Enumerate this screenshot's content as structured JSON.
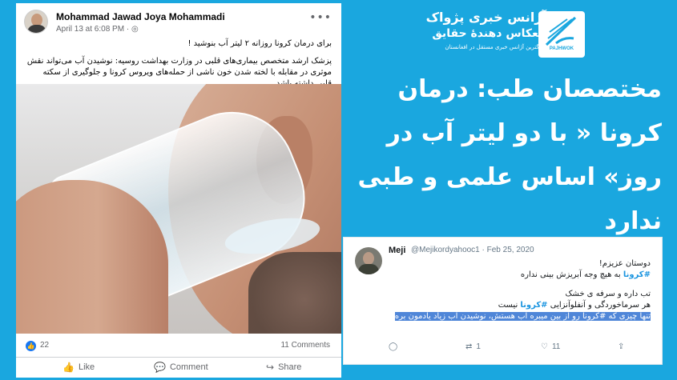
{
  "facebook_post": {
    "author": "Mohammad Jawad Joya Mohammadi",
    "date": "April 13 at 6:08 PM · ",
    "globe_glyph": "◎",
    "more_glyph": "•••",
    "text_line1": "برای درمان کرونا روزانه ۲ لیتر آب بنوشید !",
    "text_line2": "پزشک ارشد متخصص بیماری‌های قلبی در وزارت بهداشت روسیه: نوشیدن آب می‌تواند نقش موثری در مقابله با لخته شدن خون ناشی از حمله‌های ویروس کرونا و جلوگیری از سکته قلبی داشته باشد",
    "like_count": "22",
    "comment_count": "11 Comments",
    "actions": {
      "like": "Like",
      "comment": "Comment",
      "share": "Share"
    },
    "icons": {
      "like": "thumbs-up-icon",
      "comment": "speech-bubble-icon",
      "share": "share-arrow-icon"
    }
  },
  "agency": {
    "name_line1": "آژانس خبری پژواک",
    "name_line2": "انعکاس دهندهٔ حقایق",
    "tagline": "بزرگترین آژانس خبری مستقل در افغانستان",
    "logo_caption": "PAJHWOK",
    "accent_color": "#1aa7df"
  },
  "headline": "مختصصان طب: درمان کرونا « با دو لیتر آب در روز» اساس علمی و طبی ندارد",
  "tweet": {
    "name": "Meji",
    "handle_date": "@Mejikordyahooc1 · Feb 25, 2020",
    "line1": "دوستان عزیزم!",
    "tag1": "#کرونا",
    "line2_rest": " به هیچ وجه آبریزش بینی نداره",
    "line3": "تب داره و سرفه ی خشک",
    "line4_start": "هر سرماخوردگی و آنفلوآنزایی ",
    "tag2": "#کرونا",
    "line4_end": " نیست",
    "line5": "تنها چیزی که #کرونا رو از بین میبره آب هستش، نوشیدن آب زیاد یادمون بره",
    "reply_count": "",
    "retweet_count": "1",
    "like_count": "11"
  }
}
